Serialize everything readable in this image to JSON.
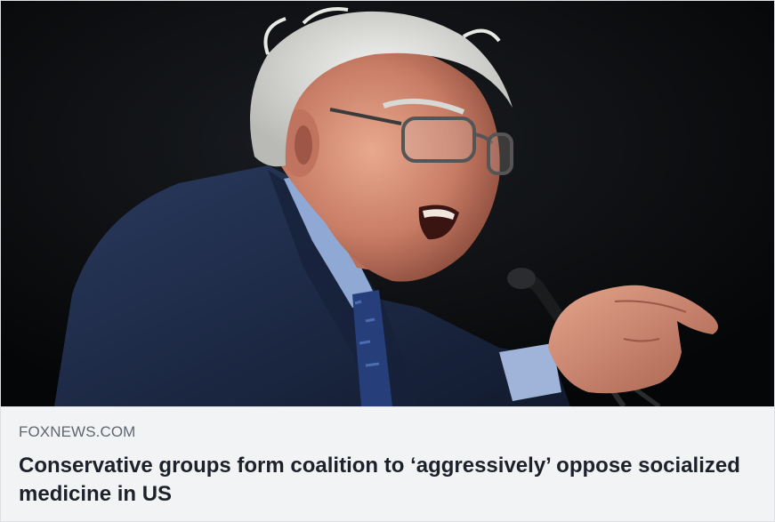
{
  "link_preview": {
    "domain": "FOXNEWS.COM",
    "headline": "Conservative groups form coalition to ‘aggressively’ oppose socialized medicine in US"
  },
  "colors": {
    "image_background": "#07090c",
    "caption_background": "#f2f3f5",
    "domain_text": "#606770",
    "headline_text": "#1d2129"
  }
}
